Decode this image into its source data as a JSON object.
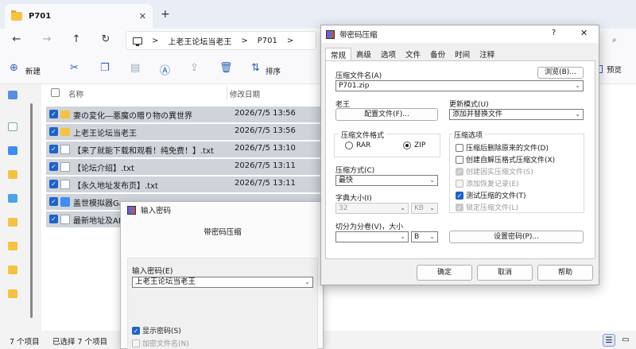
{
  "explorer": {
    "tab_title": "P701",
    "tab_close": "✕",
    "new_tab": "+",
    "breadcrumb": [
      "上老王论坛当老王",
      "P701"
    ],
    "breadcrumb_sep": ">",
    "toolbar": {
      "new_label": "新建",
      "sort_label": "排序",
      "more": "···",
      "preview_label": "预览"
    },
    "columns": {
      "name": "名称",
      "date": "修改日期"
    },
    "rows": [
      {
        "name": "妻の変化―悪魔の贈り物の異世界",
        "date": "2026/7/5 13:56",
        "icon": "folder"
      },
      {
        "name": "上老王论坛当老王",
        "date": "2026/7/5 13:56",
        "icon": "folder"
      },
      {
        "name": "【来了就能下载和观看！纯免费！】.txt",
        "date": "2026/7/5 13:10",
        "icon": "txt"
      },
      {
        "name": "【论坛介绍】.txt",
        "date": "2026/7/5 13:11",
        "icon": "txt"
      },
      {
        "name": "【永久地址发布页】.txt",
        "date": "2026/7/5 13:11",
        "icon": "txt"
      },
      {
        "name": "盖世模拟器Gam",
        "date": "",
        "icon": "app"
      },
      {
        "name": "最新地址及APF",
        "date": "",
        "icon": "txt"
      }
    ],
    "status": {
      "count": "7 个项目",
      "selected": "已选择 7 个项目"
    }
  },
  "password_dialog": {
    "title": "输入密码",
    "subtitle": "带密码压缩",
    "field_label": "输入密码(E)",
    "field_value": "上老王论坛当老王",
    "show_password": "显示密码(S)",
    "encrypt_names": "加密文件名(N)"
  },
  "archive_dialog": {
    "title": "带密码压缩",
    "help": "?",
    "close": "✕",
    "tabs": [
      "常规",
      "高级",
      "选项",
      "文件",
      "备份",
      "时间",
      "注释"
    ],
    "archive_name_label": "压缩文件名(A)",
    "archive_name_value": "P701.zip",
    "browse_button": "浏览(B)...",
    "profile_label": "老王",
    "profile_button": "配置文件(F)...",
    "update_mode_label": "更新模式(U)",
    "update_mode_value": "添加并替换文件",
    "format_label": "压缩文件格式",
    "format_rar": "RAR",
    "format_zip": "ZIP",
    "method_label": "压缩方式(C)",
    "method_value": "最快",
    "dict_label": "字典大小(I)",
    "dict_value": "32",
    "dict_unit": "KB",
    "split_label": "切分为分卷(V)，大小",
    "split_unit": "B",
    "options_label": "压缩选项",
    "options": [
      {
        "label": "压缩后删除原来的文件(D)",
        "checked": false,
        "disabled": false
      },
      {
        "label": "创建自解压格式压缩文件(X)",
        "checked": false,
        "disabled": false
      },
      {
        "label": "创建固实压缩文件(S)",
        "checked": true,
        "disabled": true
      },
      {
        "label": "添加恢复记录(E)",
        "checked": false,
        "disabled": true
      },
      {
        "label": "测试压缩的文件(T)",
        "checked": true,
        "disabled": false
      },
      {
        "label": "锁定压缩文件(L)",
        "checked": true,
        "disabled": true
      }
    ],
    "set_password_button": "设置密码(P)...",
    "ok": "确定",
    "cancel": "取消",
    "help_button": "帮助"
  }
}
